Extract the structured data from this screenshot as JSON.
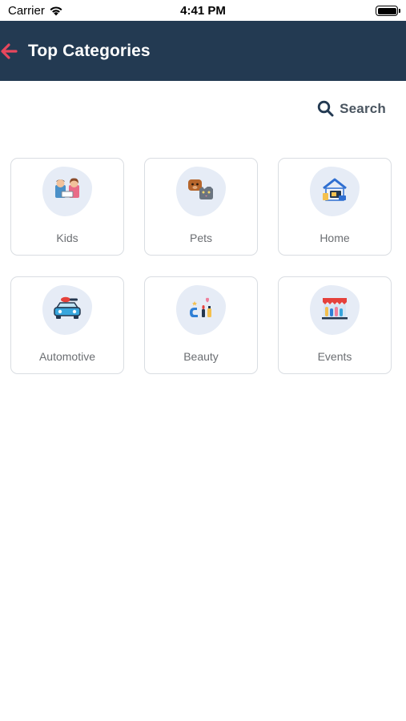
{
  "status_bar": {
    "carrier": "Carrier",
    "time": "4:41 PM"
  },
  "app_bar": {
    "title": "Top Categories",
    "accent_color": "#e8475d",
    "background": "#233a52"
  },
  "search": {
    "label": "Search"
  },
  "categories": [
    {
      "label": "Kids",
      "icon": "kids-icon"
    },
    {
      "label": "Pets",
      "icon": "pets-icon"
    },
    {
      "label": "Home",
      "icon": "home-icon"
    },
    {
      "label": "Automotive",
      "icon": "car-icon"
    },
    {
      "label": "Beauty",
      "icon": "beauty-icon"
    },
    {
      "label": "Events",
      "icon": "events-icon"
    }
  ]
}
